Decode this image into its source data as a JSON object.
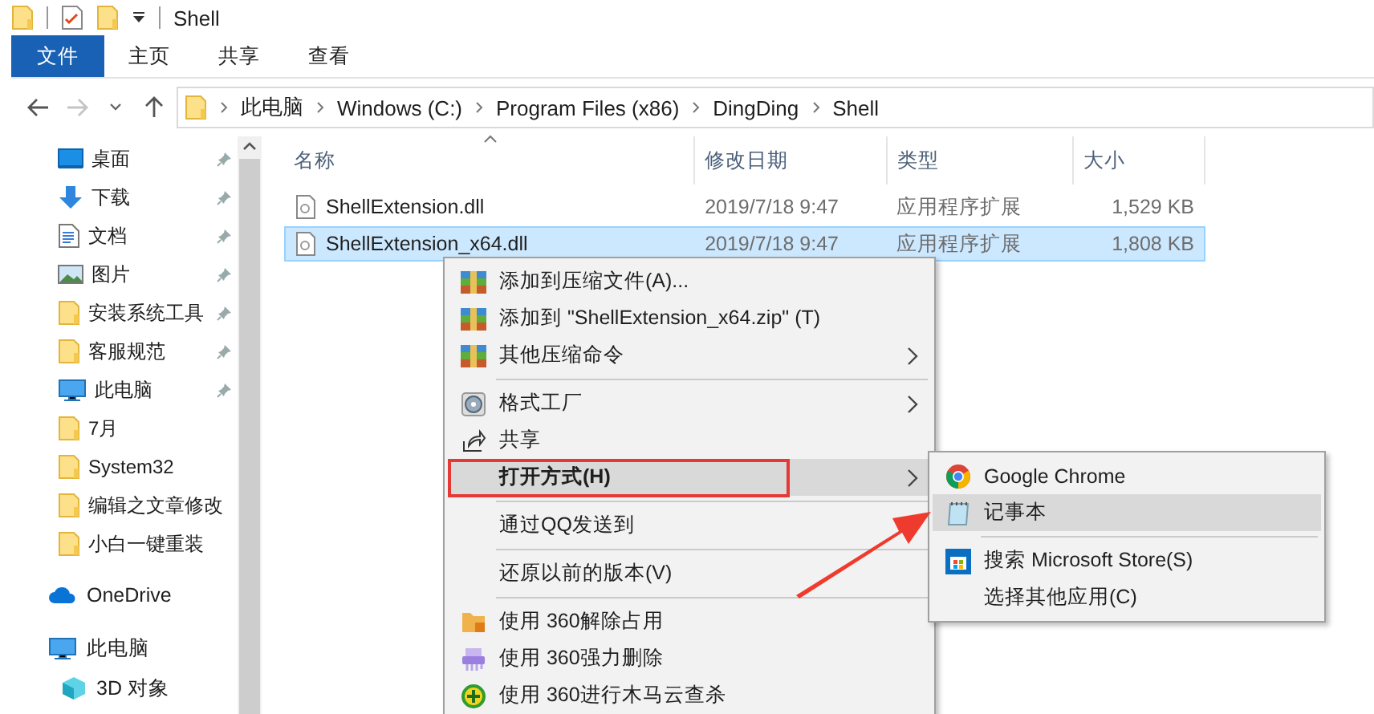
{
  "title_bar": {
    "title": "Shell"
  },
  "ribbon_tabs": [
    {
      "label": "文件",
      "selected": true
    },
    {
      "label": "主页",
      "selected": false
    },
    {
      "label": "共享",
      "selected": false
    },
    {
      "label": "查看",
      "selected": false
    }
  ],
  "address_bar": {
    "path": [
      "此电脑",
      "Windows (C:)",
      "Program Files (x86)",
      "DingDing",
      "Shell"
    ]
  },
  "nav_pane": {
    "quick_access": [
      {
        "label": "桌面",
        "kind": "desktop",
        "pinned": true
      },
      {
        "label": "下载",
        "kind": "download",
        "pinned": true
      },
      {
        "label": "文档",
        "kind": "document",
        "pinned": true
      },
      {
        "label": "图片",
        "kind": "pictures",
        "pinned": true
      },
      {
        "label": "安装系统工具",
        "kind": "folder",
        "pinned": true
      },
      {
        "label": "客服规范",
        "kind": "folder",
        "pinned": true
      },
      {
        "label": "此电脑",
        "kind": "pc",
        "pinned": true
      },
      {
        "label": "7月",
        "kind": "folder",
        "pinned": false
      },
      {
        "label": "System32",
        "kind": "folder",
        "pinned": false
      },
      {
        "label": "编辑之文章修改",
        "kind": "folder",
        "pinned": false
      },
      {
        "label": "小白一键重装",
        "kind": "folder",
        "pinned": false
      }
    ],
    "roots": [
      {
        "label": "OneDrive",
        "kind": "cloud"
      },
      {
        "label": "此电脑",
        "kind": "pc",
        "children": [
          {
            "label": "3D 对象",
            "kind": "cube"
          }
        ]
      }
    ]
  },
  "file_list": {
    "columns": [
      {
        "label": "名称",
        "sorted": true
      },
      {
        "label": "修改日期",
        "sorted": false
      },
      {
        "label": "类型",
        "sorted": false
      },
      {
        "label": "大小",
        "sorted": false
      }
    ],
    "rows": [
      {
        "name": "ShellExtension.dll",
        "modified": "2019/7/18 9:47",
        "type": "应用程序扩展",
        "size": "1,529 KB",
        "selected": false
      },
      {
        "name": "ShellExtension_x64.dll",
        "modified": "2019/7/18 9:47",
        "type": "应用程序扩展",
        "size": "1,808 KB",
        "selected": true
      }
    ]
  },
  "context_menu": {
    "items": [
      {
        "kind": "archive",
        "label": "添加到压缩文件(A)...",
        "submenu": false,
        "selected": false,
        "default": false,
        "highlighted": false
      },
      {
        "kind": "archive",
        "label": "添加到 \"ShellExtension_x64.zip\" (T)",
        "submenu": false,
        "selected": false,
        "default": false,
        "highlighted": false
      },
      {
        "kind": "archive",
        "label": "其他压缩命令",
        "submenu": true,
        "selected": false,
        "default": false,
        "highlighted": false
      },
      {
        "kind": "separator"
      },
      {
        "kind": "disc",
        "label": "格式工厂",
        "submenu": true,
        "selected": false,
        "default": false,
        "highlighted": false
      },
      {
        "kind": "share",
        "label": "共享",
        "submenu": false,
        "selected": false,
        "default": false,
        "highlighted": false
      },
      {
        "kind": "plain",
        "label": "打开方式(H)",
        "submenu": true,
        "selected": true,
        "default": true,
        "highlighted": true
      },
      {
        "kind": "separator"
      },
      {
        "kind": "plain",
        "label": "通过QQ发送到",
        "submenu": false,
        "selected": false,
        "default": false,
        "highlighted": false
      },
      {
        "kind": "separator"
      },
      {
        "kind": "plain",
        "label": "还原以前的版本(V)",
        "submenu": false,
        "selected": false,
        "default": false,
        "highlighted": false
      },
      {
        "kind": "separator"
      },
      {
        "kind": "lock",
        "label": "使用 360解除占用",
        "submenu": false,
        "selected": false,
        "default": false,
        "highlighted": false
      },
      {
        "kind": "shredder",
        "label": "使用 360强力删除",
        "submenu": false,
        "selected": false,
        "default": false,
        "highlighted": false
      },
      {
        "kind": "shield",
        "label": "使用 360进行木马云查杀",
        "submenu": false,
        "selected": false,
        "default": false,
        "highlighted": false
      }
    ]
  },
  "open_with_menu": {
    "items": [
      {
        "kind": "browser",
        "label": "Google Chrome",
        "selected": false,
        "pointed": false
      },
      {
        "kind": "notepad",
        "label": "记事本",
        "selected": true,
        "pointed": true
      },
      {
        "kind": "separator"
      },
      {
        "kind": "store",
        "label": "搜索 Microsoft Store(S)",
        "selected": false,
        "pointed": false
      },
      {
        "kind": "plain",
        "label": "选择其他应用(C)",
        "selected": false,
        "pointed": false
      }
    ]
  }
}
